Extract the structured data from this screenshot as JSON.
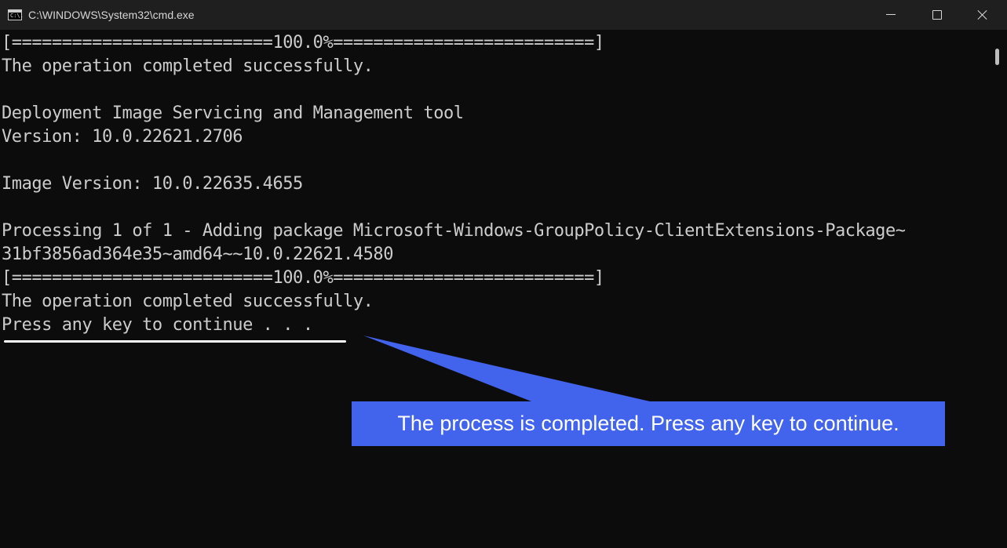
{
  "window": {
    "title": "C:\\WINDOWS\\System32\\cmd.exe",
    "icon_text": "C:\\."
  },
  "console": {
    "lines": [
      "[==========================100.0%==========================]",
      "The operation completed successfully.",
      "",
      "Deployment Image Servicing and Management tool",
      "Version: 10.0.22621.2706",
      "",
      "Image Version: 10.0.22635.4655",
      "",
      "Processing 1 of 1 - Adding package Microsoft-Windows-GroupPolicy-ClientExtensions-Package~",
      "31bf3856ad364e35~amd64~~10.0.22621.4580",
      "[==========================100.0%==========================]",
      "The operation completed successfully.",
      "Press any key to continue . . ."
    ]
  },
  "annotation": {
    "callout_text": "The process is completed. Press any key to continue.",
    "callout_color": "#4263eb",
    "underline_color": "#ffffff"
  },
  "colors": {
    "console_bg": "#0c0c0c",
    "console_text": "#cccccc",
    "titlebar_bg": "#1f1f1f"
  }
}
